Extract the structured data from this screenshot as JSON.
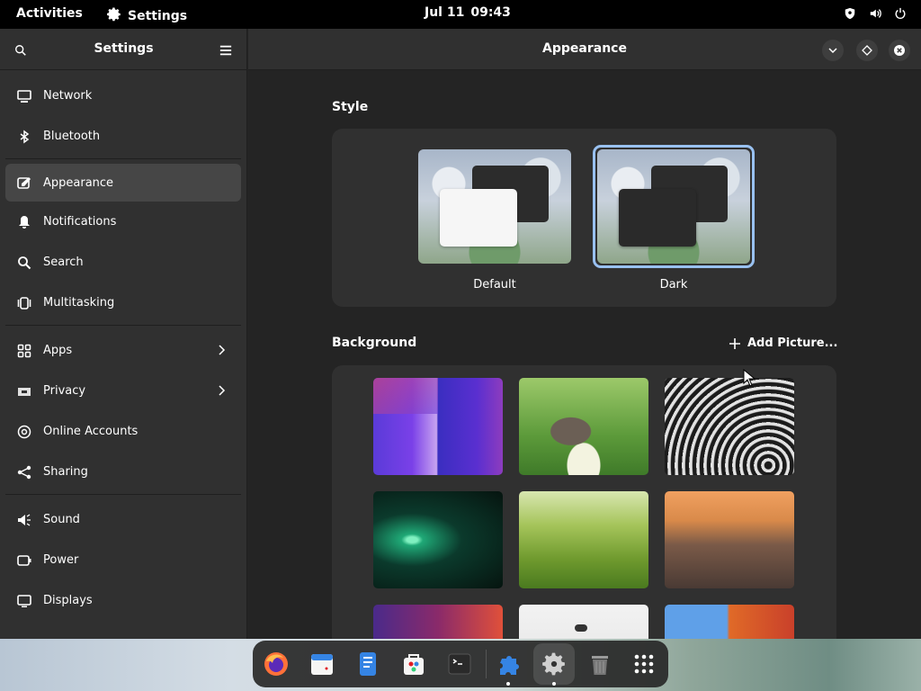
{
  "topbar": {
    "activities": "Activities",
    "app_name": "Settings",
    "date": "Jul 11",
    "time": "09:43",
    "tray_icons": [
      "shield-icon",
      "volume-icon",
      "power-icon"
    ]
  },
  "sidebar": {
    "title": "Settings",
    "groups": [
      [
        {
          "label": "Network",
          "icon": "network-icon"
        },
        {
          "label": "Bluetooth",
          "icon": "bluetooth-icon"
        }
      ],
      [
        {
          "label": "Appearance",
          "icon": "appearance-icon",
          "active": true
        },
        {
          "label": "Notifications",
          "icon": "bell-icon"
        },
        {
          "label": "Search",
          "icon": "search-icon"
        },
        {
          "label": "Multitasking",
          "icon": "multitasking-icon"
        }
      ],
      [
        {
          "label": "Apps",
          "icon": "apps-icon",
          "chevron": true
        },
        {
          "label": "Privacy",
          "icon": "privacy-icon",
          "chevron": true
        },
        {
          "label": "Online Accounts",
          "icon": "at-icon"
        },
        {
          "label": "Sharing",
          "icon": "share-icon"
        }
      ],
      [
        {
          "label": "Sound",
          "icon": "speaker-icon"
        },
        {
          "label": "Power",
          "icon": "power-icon"
        },
        {
          "label": "Displays",
          "icon": "display-icon"
        }
      ]
    ]
  },
  "content": {
    "title": "Appearance",
    "style_section": "Style",
    "style_options": [
      {
        "label": "Default",
        "selected": false
      },
      {
        "label": "Dark",
        "selected": true
      }
    ],
    "background_section": "Background",
    "add_picture": "Add Picture...",
    "wallpapers": [
      "abstract-purple",
      "kitten-in-grass",
      "spiral-architecture",
      "green-light-burst",
      "green-hills",
      "city-sunset",
      "purple-orange-gradient",
      "white-bird",
      "colorful-blocks"
    ]
  },
  "dock": {
    "apps": [
      "firefox-icon",
      "calendar-icon",
      "text-editor-icon",
      "software-icon",
      "terminal-icon",
      "extensions-icon",
      "settings-icon",
      "trash-icon",
      "app-grid-icon"
    ],
    "accent": "#99c1f1"
  }
}
